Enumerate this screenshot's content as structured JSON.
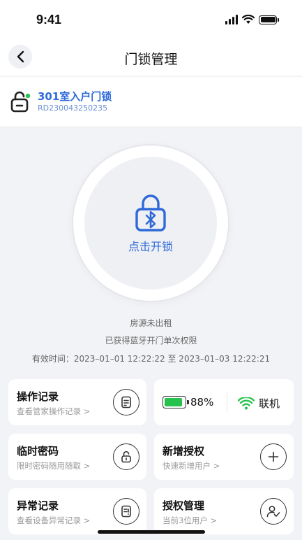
{
  "status_bar": {
    "time": "9:41"
  },
  "nav": {
    "title": "门锁管理",
    "back_icon": "chevron-left-icon"
  },
  "lock": {
    "name": "301室入户门锁",
    "code": "RD230043250235",
    "online_dot_color": "#27c24c"
  },
  "unlock": {
    "label": "点击开锁",
    "icon": "bluetooth-lock-icon",
    "accent": "#2f6ad8"
  },
  "info": {
    "status": "房源未出租",
    "permission": "已获得蓝牙开门单次权限",
    "validity": "有效时间：2023–01–01 12:22:22 至 2023–01–03 12:22:21"
  },
  "cards": {
    "operation_log": {
      "title": "操作记录",
      "sub": "查看管家操作记录 >",
      "icon": "document-icon"
    },
    "device_status": {
      "battery_pct": "88%",
      "battery_level": 0.88,
      "online_label": "联机",
      "battery_color": "#27c24c",
      "wifi_color": "#27c24c"
    },
    "temp_password": {
      "title": "临时密码",
      "sub": "限时密码随用随取 >",
      "icon": "unlock-icon"
    },
    "add_auth": {
      "title": "新增授权",
      "sub": "快速新增用户 >",
      "icon": "plus-icon"
    },
    "abnormal_log": {
      "title": "异常记录",
      "sub": "查看设备异常记录 >",
      "icon": "alert-document-icon"
    },
    "auth_manage": {
      "title": "授权管理",
      "sub": "当前3位用户 >",
      "icon": "user-check-icon"
    }
  }
}
